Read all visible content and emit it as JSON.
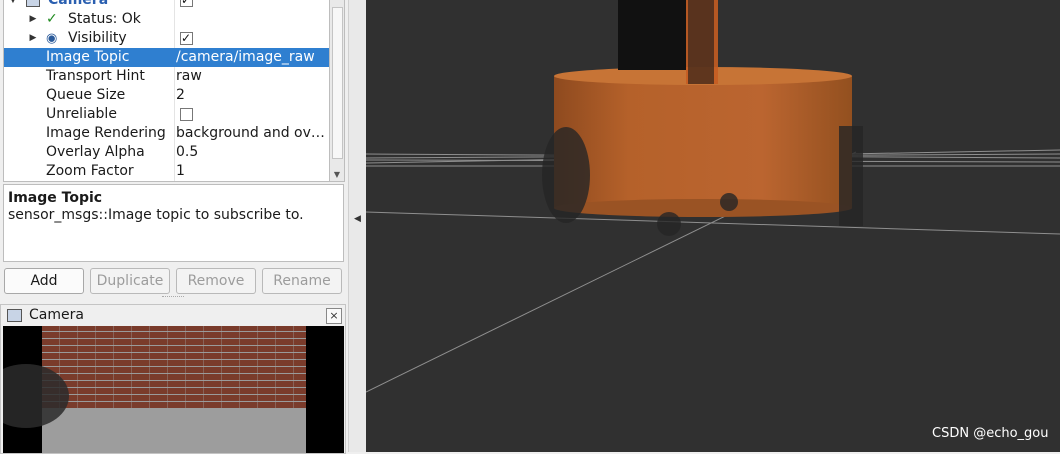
{
  "tree": {
    "rows": [
      {
        "label": "Camera",
        "value": ""
      },
      {
        "label": "Status: Ok",
        "value": ""
      },
      {
        "label": "Visibility",
        "value": ""
      },
      {
        "label": "Image Topic",
        "value": "/camera/image_raw"
      },
      {
        "label": "Transport Hint",
        "value": "raw"
      },
      {
        "label": "Queue Size",
        "value": "2"
      },
      {
        "label": "Unreliable",
        "value": ""
      },
      {
        "label": "Image Rendering",
        "value": "background and ov…"
      },
      {
        "label": "Overlay Alpha",
        "value": "0.5"
      },
      {
        "label": "Zoom Factor",
        "value": "1"
      }
    ],
    "checkboxes": {
      "camera_enabled": true,
      "visibility": true,
      "unreliable": false
    },
    "selected_row": "Image Topic",
    "selection_color": "#2f7fd0",
    "camera_label_color": "#2a5fb0"
  },
  "description": {
    "title": "Image Topic",
    "text": "sensor_msgs::Image topic to subscribe to."
  },
  "buttons": {
    "add": "Add",
    "duplicate": "Duplicate",
    "remove": "Remove",
    "rename": "Rename"
  },
  "camera_panel": {
    "title": "Camera",
    "close": "×"
  },
  "viewport": {
    "background": "#303030",
    "cylinder_color": "#b5612a",
    "watermark": "CSDN @echo_gou"
  }
}
